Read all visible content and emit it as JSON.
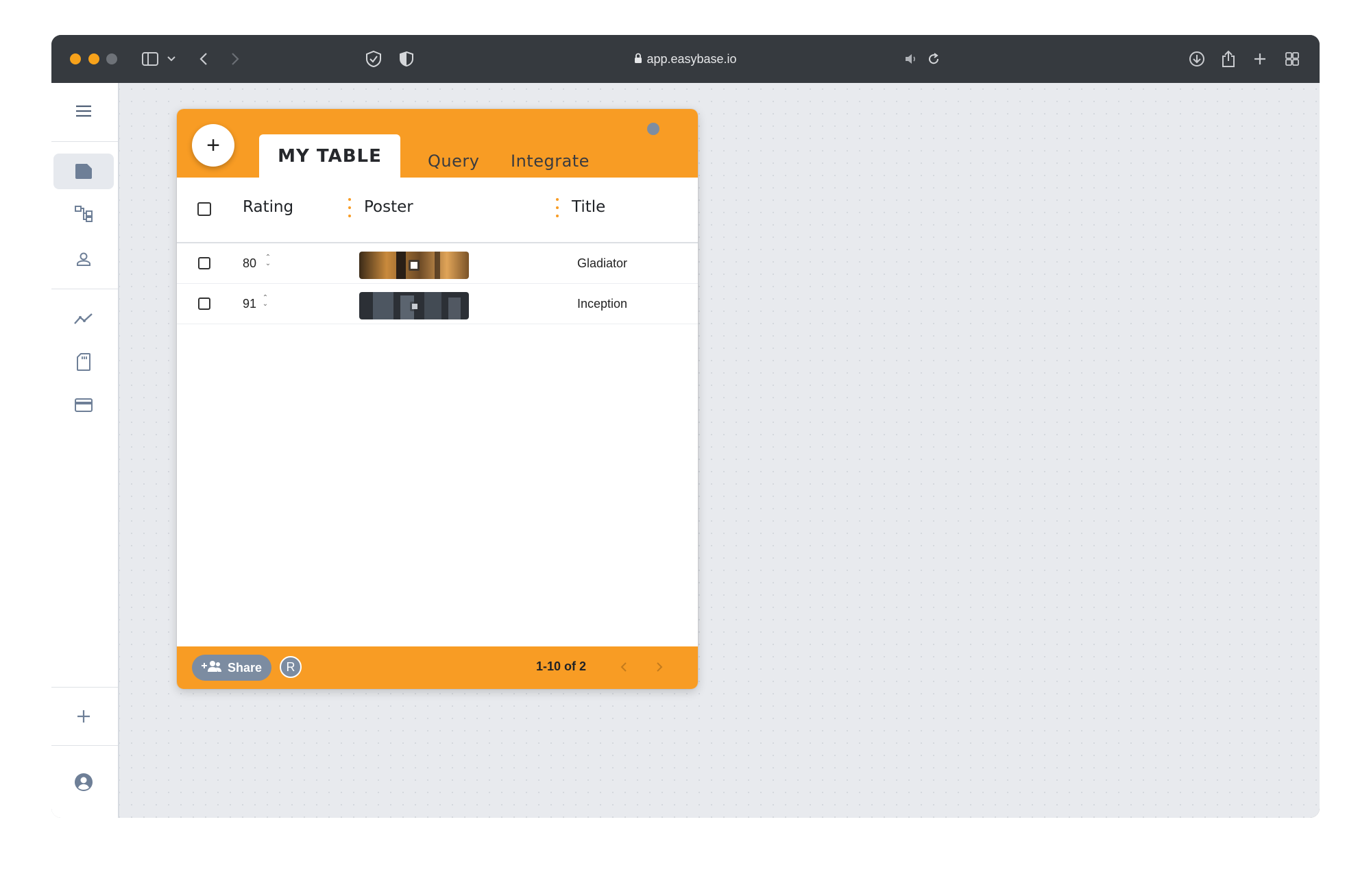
{
  "browser": {
    "url": "app.easybase.io",
    "traffic_colors": [
      "#f7a21b",
      "#f7a21b",
      "#6e7278"
    ],
    "icons": [
      "sidebar-toggle-icon",
      "chevron-down-icon",
      "back-icon",
      "forward-icon",
      "privacy-shield-icon",
      "security-shield-icon",
      "lock-icon",
      "speaker-icon",
      "reload-icon",
      "download-icon",
      "share-icon",
      "new-tab-icon",
      "tab-overview-icon"
    ]
  },
  "sidebar": {
    "items": [
      {
        "name": "menu-icon"
      },
      {
        "name": "table-icon",
        "active": true
      },
      {
        "name": "hierarchy-icon"
      },
      {
        "name": "user-icon"
      },
      {
        "name": "analytics-icon"
      },
      {
        "name": "storage-card-icon"
      },
      {
        "name": "billing-card-icon"
      },
      {
        "name": "add-icon"
      },
      {
        "name": "account-icon"
      }
    ]
  },
  "card": {
    "add_label": "+",
    "tabs": {
      "active": "MY TABLE",
      "query": "Query",
      "integrate": "Integrate"
    },
    "accent": "#f89c24",
    "columns": [
      "Rating",
      "Poster",
      "Title"
    ],
    "rows": [
      {
        "rating": "80",
        "title": "Gladiator"
      },
      {
        "rating": "91",
        "title": "Inception"
      }
    ],
    "footer": {
      "share_label": "Share",
      "avatar_initial": "R",
      "pagination": "1-10 of 2"
    }
  }
}
